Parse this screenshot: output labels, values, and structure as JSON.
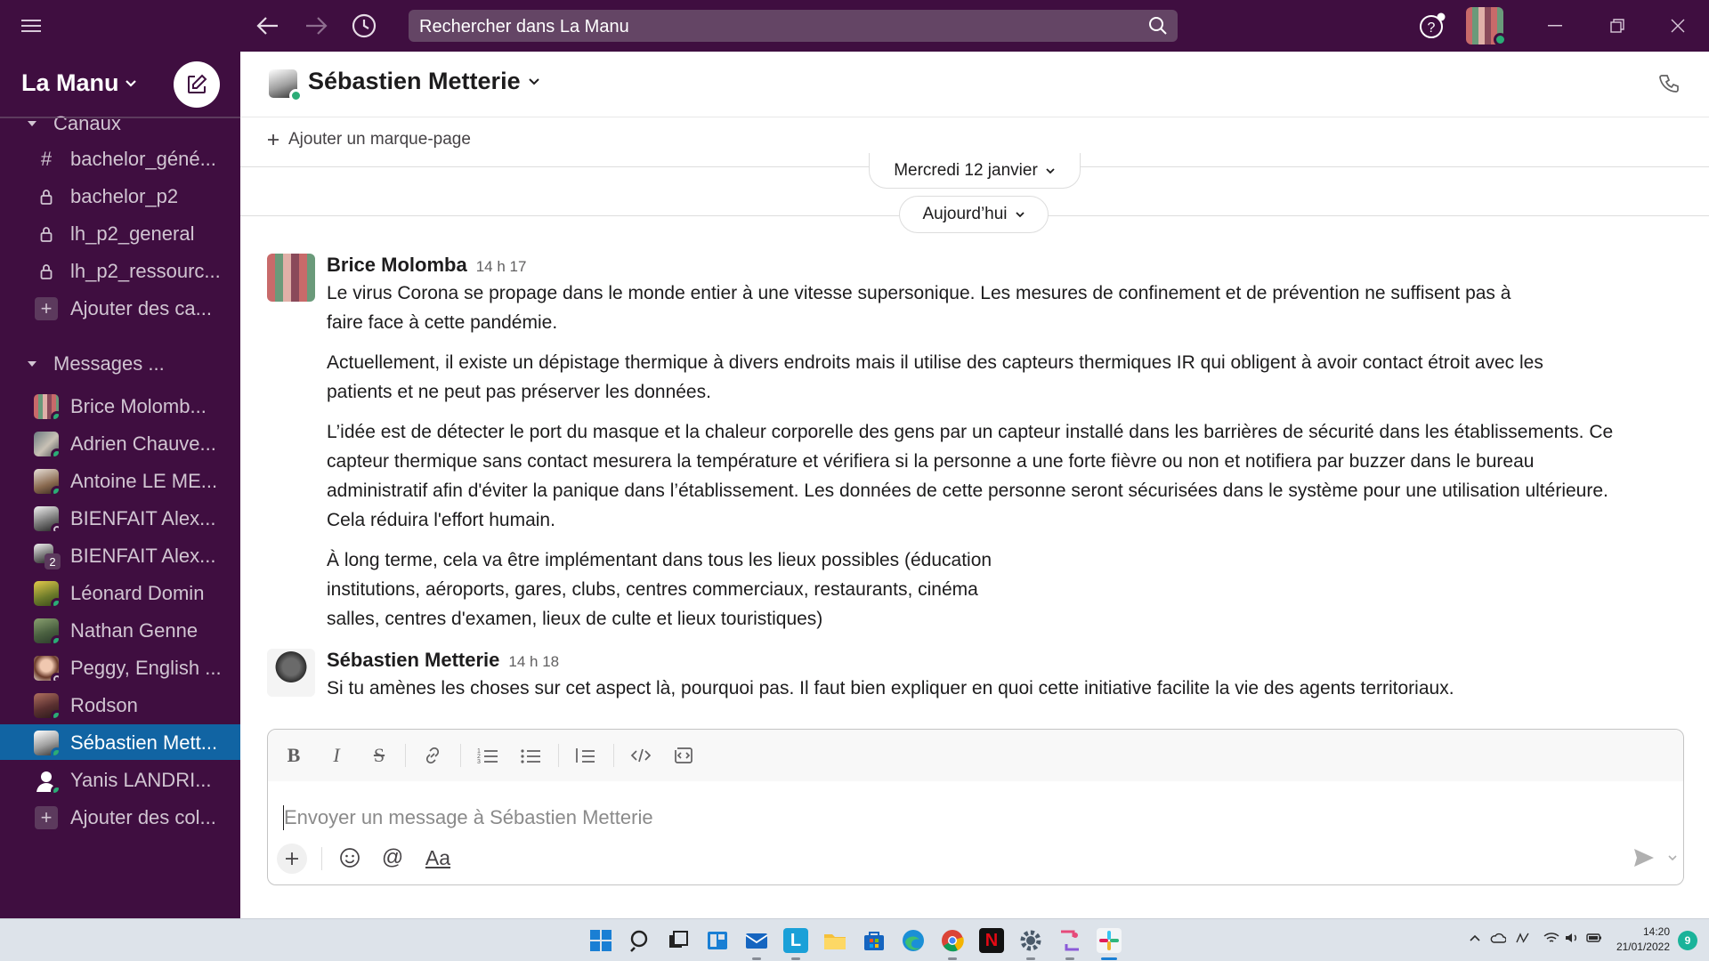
{
  "topbar": {
    "search_placeholder": "Rechercher dans La Manu"
  },
  "sidebar": {
    "workspace_name": "La Manu",
    "channels_header": "Canaux",
    "channels": [
      {
        "icon": "hash-icon",
        "label": "bachelor_géné..."
      },
      {
        "icon": "lock-icon",
        "label": "bachelor_p2"
      },
      {
        "icon": "lock-icon",
        "label": "lh_p2_general"
      },
      {
        "icon": "lock-icon",
        "label": "lh_p2_ressourc..."
      }
    ],
    "add_channels": "Ajouter des ca...",
    "messages_header": "Messages ...",
    "dms": [
      {
        "label": "Brice Molomb...",
        "status": "online"
      },
      {
        "label": "Adrien Chauve...",
        "status": "online"
      },
      {
        "label": "Antoine LE ME...",
        "status": "online"
      },
      {
        "label": "BIENFAIT Alex...",
        "status": "away"
      },
      {
        "label": "BIENFAIT Alex...",
        "status": "group",
        "badge": "2"
      },
      {
        "label": "Léonard Domin",
        "status": "online"
      },
      {
        "label": "Nathan Genne",
        "status": "online"
      },
      {
        "label": "Peggy, English ...",
        "status": "away"
      },
      {
        "label": "Rodson",
        "status": "online"
      },
      {
        "label": "Sébastien Mett...",
        "status": "online",
        "active": true
      },
      {
        "label": "Yanis LANDRI...",
        "status": "online"
      }
    ],
    "add_colleagues": "Ajouter des col..."
  },
  "channel": {
    "title": "Sébastien Metterie",
    "bookmark_label": "Ajouter un marque-page"
  },
  "dates": {
    "previous": "Mercredi 12 janvier",
    "today": "Aujourd’hui"
  },
  "messages": [
    {
      "author": "Brice Molomba",
      "time": "14 h 17",
      "paragraphs": [
        [
          "Le virus Corona se propage dans le monde entier à une vitesse supersonique. Les mesures de confinement et de prévention ne suffisent pas à",
          "faire face à cette pandémie."
        ],
        [
          "Actuellement, il existe un dépistage thermique à divers endroits mais il utilise des capteurs thermiques IR qui obligent à avoir contact étroit avec les",
          "patients et ne peut pas préserver les données."
        ],
        [
          "L’idée est de détecter le port du masque et la chaleur corporelle des gens par un capteur installé dans les barrières de sécurité dans les établissements. Ce",
          "capteur thermique sans contact mesurera la température et vérifiera si la personne a une forte fièvre ou non et notifiera par buzzer dans le bureau",
          "administratif afin d'éviter la panique dans l’établissement. Les données de cette personne seront sécurisées dans le système pour une utilisation ultérieure.",
          "Cela réduira l'effort humain."
        ],
        [
          "À long terme, cela va être implémentant dans tous les lieux possibles (éducation",
          "institutions, aéroports, gares, clubs, centres commerciaux, restaurants, cinéma",
          "salles, centres d'examen, lieux de culte et lieux touristiques)"
        ]
      ]
    },
    {
      "author": "Sébastien Metterie",
      "time": "14 h 18",
      "paragraphs": [
        [
          "Si tu amènes les choses sur cet aspect là, pourquoi pas. Il faut bien expliquer en quoi cette initiative facilite la vie des agents territoriaux."
        ]
      ]
    }
  ],
  "composer": {
    "placeholder": "Envoyer un message à Sébastien Metterie",
    "format_label": "Aa"
  },
  "taskbar": {
    "time": "14:20",
    "date": "21/01/2022",
    "notifications": "9"
  },
  "colors": {
    "aubergine": "#3f0e40",
    "active": "#1164a3",
    "online": "#2bac76"
  }
}
